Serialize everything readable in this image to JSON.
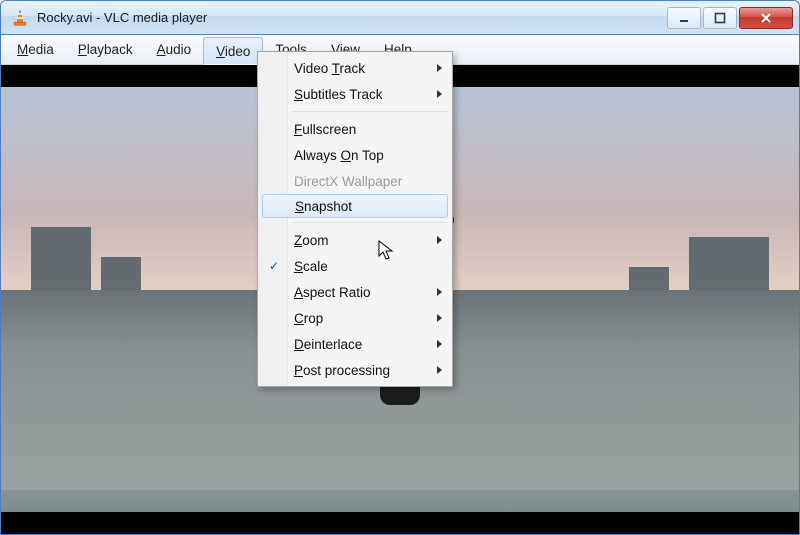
{
  "titlebar": {
    "title": "Rocky.avi - VLC media player",
    "icon_name": "vlc-cone-icon"
  },
  "window_controls": {
    "minimize": "minimize",
    "maximize": "maximize",
    "close": "close"
  },
  "menubar": {
    "items": [
      {
        "label": "Media",
        "accel_index": 0
      },
      {
        "label": "Playback",
        "accel_index": 0
      },
      {
        "label": "Audio",
        "accel_index": 0
      },
      {
        "label": "Video",
        "accel_index": 0,
        "active": true
      },
      {
        "label": "Tools",
        "accel_index": 0
      },
      {
        "label": "View",
        "accel_index": 3
      },
      {
        "label": "Help",
        "accel_index": 0
      }
    ]
  },
  "video_menu": {
    "items": [
      {
        "label": "Video Track",
        "accel_index": 6,
        "submenu": true
      },
      {
        "label": "Subtitles Track",
        "accel_index": 0,
        "submenu": true
      },
      {
        "separator": true
      },
      {
        "label": "Fullscreen",
        "accel_index": 0
      },
      {
        "label": "Always On Top",
        "accel_index": 7
      },
      {
        "label": "DirectX Wallpaper",
        "disabled": true
      },
      {
        "label": "Snapshot",
        "accel_index": 0,
        "hover": true
      },
      {
        "separator": true
      },
      {
        "label": "Zoom",
        "accel_index": 0,
        "submenu": true
      },
      {
        "label": "Scale",
        "accel_index": 0,
        "checked": true
      },
      {
        "label": "Aspect Ratio",
        "accel_index": 0,
        "submenu": true
      },
      {
        "label": "Crop",
        "accel_index": 0,
        "submenu": true
      },
      {
        "label": "Deinterlace",
        "accel_index": 0,
        "submenu": true
      },
      {
        "label": "Post processing",
        "accel_index": 0,
        "submenu": true
      }
    ]
  },
  "video_content": {
    "description": "Movie still: silhouette of a person with raised fist against a dawn city skyline"
  }
}
